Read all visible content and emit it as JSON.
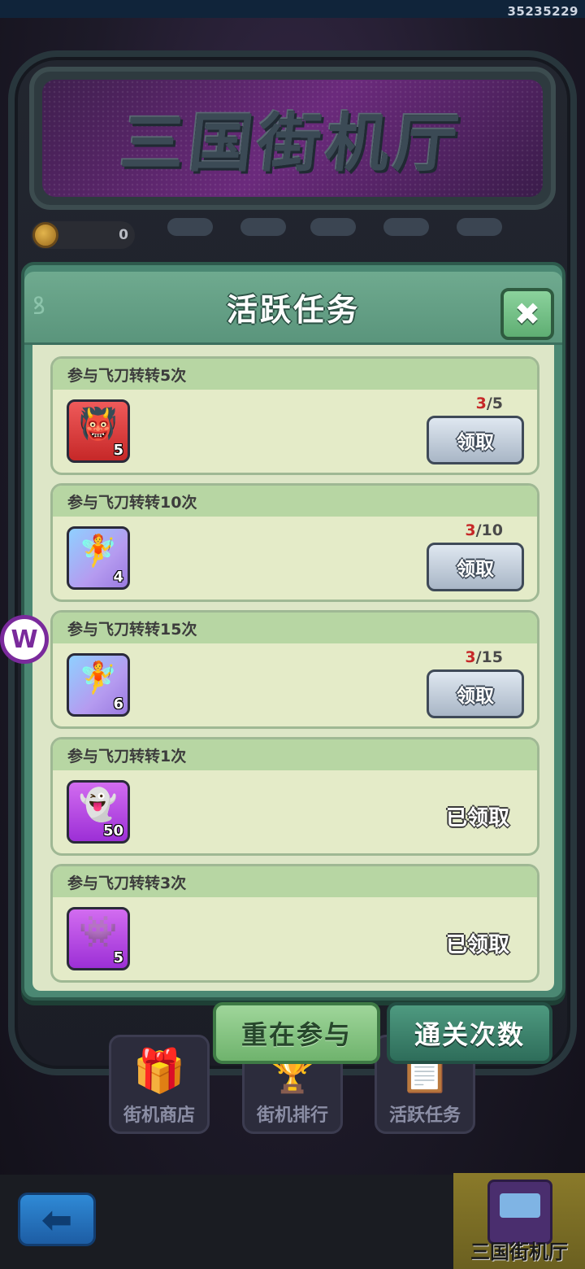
{
  "status": {
    "user_id": "35235229"
  },
  "machine": {
    "marquee_title": "三国街机厅",
    "coins": "0"
  },
  "menu": {
    "items": [
      {
        "label": "街机商店",
        "icon": "treasure-chest-icon"
      },
      {
        "label": "街机排行",
        "icon": "podium-icon"
      },
      {
        "label": "活跃任务",
        "icon": "task-book-icon"
      }
    ]
  },
  "corner": {
    "label": "三国街机厅",
    "icon": "arcade-cabinet-icon"
  },
  "side_widget": {
    "glyph": "W"
  },
  "modal": {
    "title": "活跃任务",
    "close_glyph": "✖",
    "tasks": [
      {
        "title": "参与飞刀转转5次",
        "item_count": "5",
        "progress_current": "3",
        "progress_total": "/5",
        "action": "领取",
        "item_color": "#d63a3a",
        "item_icon": "red-pet-icon"
      },
      {
        "title": "参与飞刀转转10次",
        "item_count": "4",
        "progress_current": "3",
        "progress_total": "/10",
        "action": "领取",
        "item_color": "#a9b6f0",
        "item_icon": "blue-pet-icon"
      },
      {
        "title": "参与飞刀转转15次",
        "item_count": "6",
        "progress_current": "3",
        "progress_total": "/15",
        "action": "领取",
        "item_color": "#a9b6f0",
        "item_icon": "blue-pet-icon"
      },
      {
        "title": "参与飞刀转转1次",
        "item_count": "50",
        "status": "已领取",
        "item_color": "#b53ae0",
        "item_icon": "ghost-pet-icon"
      },
      {
        "title": "参与飞刀转转3次",
        "item_count": "5",
        "status": "已领取",
        "item_color": "#b53ae0",
        "item_icon": "purple-pet-icon"
      }
    ]
  },
  "actions": {
    "rejoin_label": "重在参与",
    "clear_count_label": "通关次数"
  }
}
